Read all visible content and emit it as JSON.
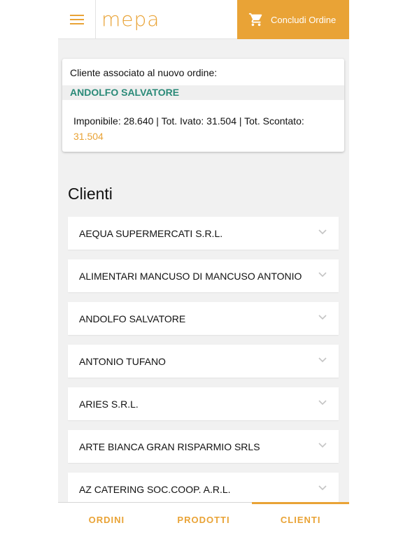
{
  "header": {
    "logo_text": "mepa",
    "conclude_label": "Concludi Ordine",
    "menu_icon": "hamburger-menu-icon",
    "cart_icon": "shopping-cart-icon"
  },
  "order_card": {
    "label": "Cliente associato al nuovo ordine:",
    "client_name": "ANDOLFO SALVATORE",
    "totals_text": "Imponibile: 28.640 | Tot. Ivato: 31.504 | Tot. Scontato:",
    "discounted_total": "31.504"
  },
  "clients": {
    "title": "Clienti",
    "items": [
      {
        "name": "AEQUA SUPERMERCATI S.R.L."
      },
      {
        "name": "ALIMENTARI MANCUSO DI MANCUSO ANTONIO"
      },
      {
        "name": "ANDOLFO SALVATORE"
      },
      {
        "name": "ANTONIO TUFANO"
      },
      {
        "name": "ARIES S.R.L."
      },
      {
        "name": "ARTE BIANCA GRAN RISPARMIO SRLS"
      },
      {
        "name": "AZ CATERING SOC.COOP. A.R.L."
      }
    ]
  },
  "tabbar": {
    "tabs": [
      {
        "label": "ORDINI"
      },
      {
        "label": "PRODOTTI"
      },
      {
        "label": "CLIENTI"
      }
    ],
    "active": "CLIENTI"
  },
  "colors": {
    "accent": "#e9a336",
    "client_name": "#2a8a78",
    "background": "#f1f1f1"
  }
}
